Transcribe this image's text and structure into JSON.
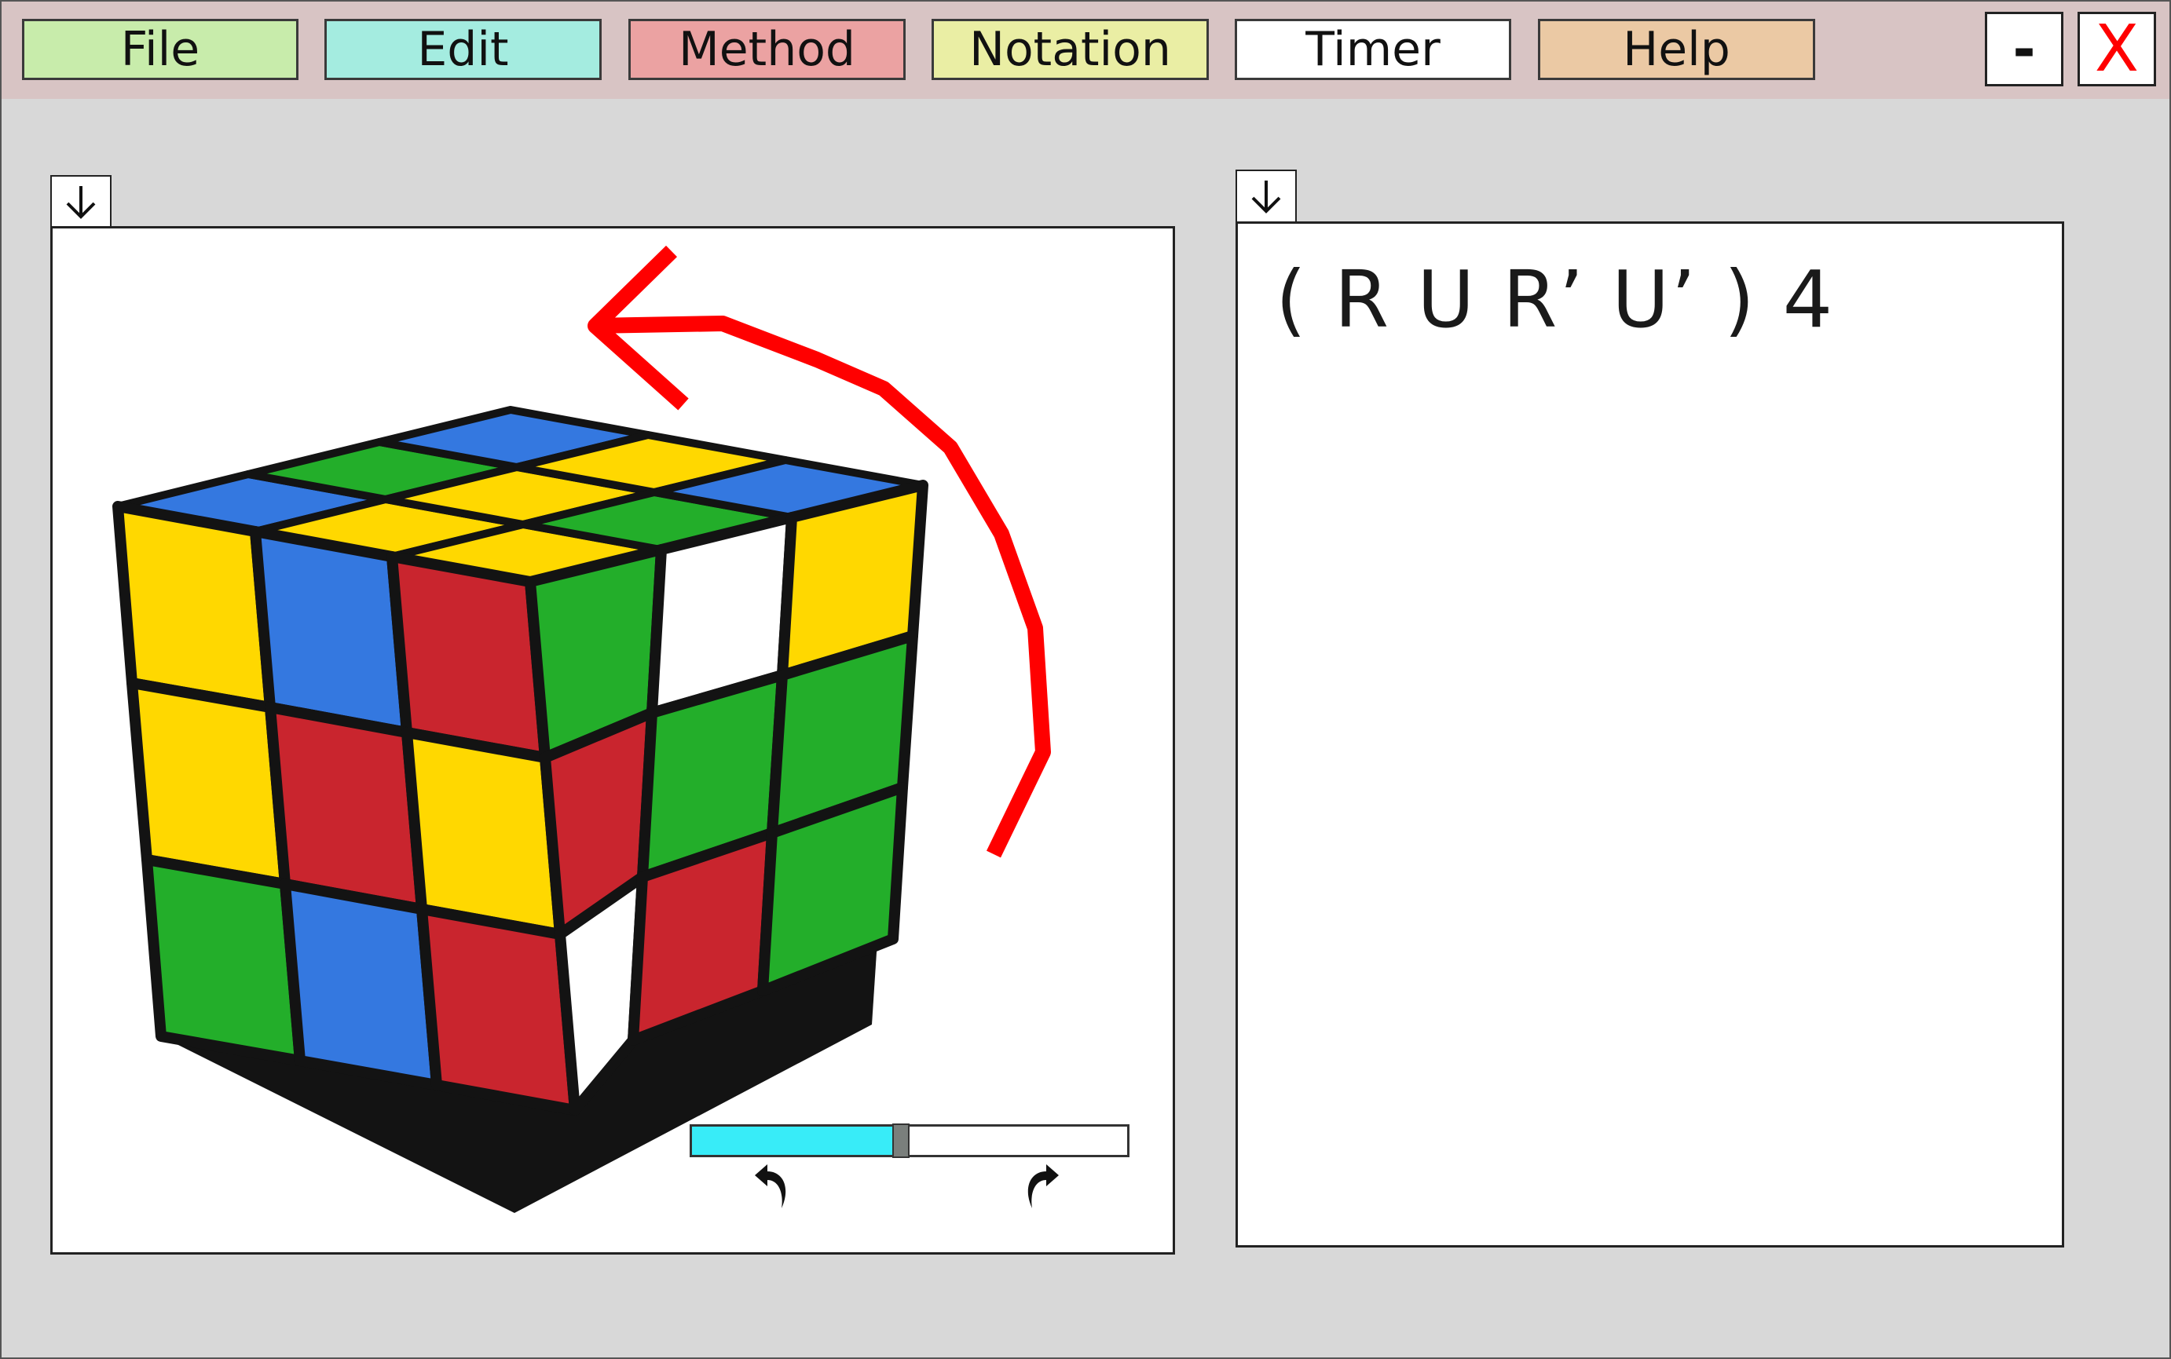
{
  "menu": {
    "items": [
      {
        "label": "File",
        "color": "#c8ecab"
      },
      {
        "label": "Edit",
        "color": "#a4ece0"
      },
      {
        "label": "Method",
        "color": "#eba2a2"
      },
      {
        "label": "Notation",
        "color": "#eaeea4"
      },
      {
        "label": "Timer",
        "color": "#ffffff"
      },
      {
        "label": "Help",
        "color": "#ebc9a4"
      }
    ]
  },
  "window_controls": {
    "minimize_label": "-",
    "close_label": "X",
    "close_color": "#ff0000"
  },
  "left_panel": {
    "collapse_icon": "down-arrow-icon",
    "cube_colors": {
      "yellow": "#ffd800",
      "blue": "#3478e0",
      "red": "#c9252e",
      "green": "#23ae2a",
      "white": "#ffffff"
    },
    "rotation_arrow_color": "#ff0000",
    "playback": {
      "progress_fraction": 0.48,
      "fill_color": "#38ecf8",
      "undo_icon": "undo-arrow-icon",
      "redo_icon": "redo-arrow-icon"
    }
  },
  "right_panel": {
    "collapse_icon": "down-arrow-icon",
    "algorithm": "( R U R’ U’ ) 4"
  }
}
